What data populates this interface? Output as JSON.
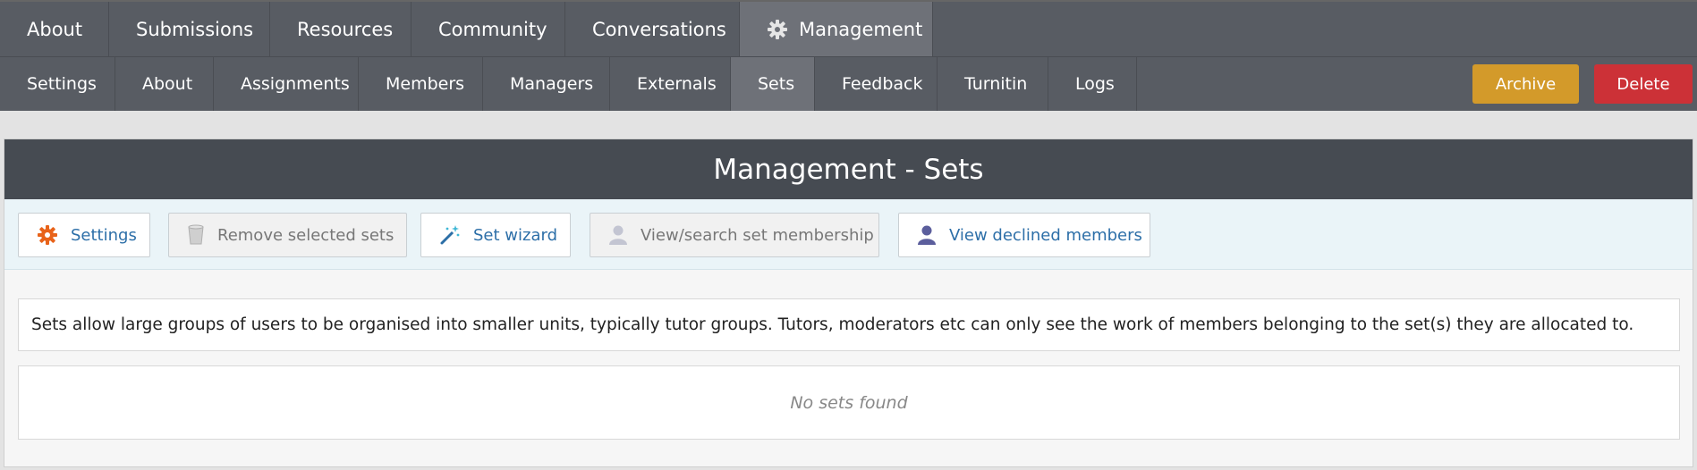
{
  "top_nav": {
    "tabs": [
      {
        "label": "About"
      },
      {
        "label": "Submissions"
      },
      {
        "label": "Resources"
      },
      {
        "label": "Community"
      },
      {
        "label": "Conversations"
      },
      {
        "label": "Management",
        "icon": "gear-icon",
        "active": true
      }
    ]
  },
  "sub_nav": {
    "tabs": [
      {
        "label": "Settings"
      },
      {
        "label": "About"
      },
      {
        "label": "Assignments"
      },
      {
        "label": "Members"
      },
      {
        "label": "Managers"
      },
      {
        "label": "Externals"
      },
      {
        "label": "Sets",
        "active": true
      },
      {
        "label": "Feedback"
      },
      {
        "label": "Turnitin"
      },
      {
        "label": "Logs"
      }
    ],
    "archive_label": "Archive",
    "delete_label": "Delete"
  },
  "panel": {
    "title": "Management - Sets",
    "toolbar": {
      "settings_label": "Settings",
      "remove_label": "Remove selected sets",
      "wizard_label": "Set wizard",
      "view_search_label": "View/search set membership",
      "declined_label": "View declined members"
    },
    "info_text": "Sets allow large groups of users to be organised into smaller units, typically tutor groups. Tutors, moderators etc can only see the work of members belonging to the set(s) they are allocated to.",
    "empty_text": "No sets found"
  },
  "colors": {
    "nav_bg": "#585c63",
    "nav_active": "#6e7178",
    "archive": "#d39a2a",
    "delete": "#cc3137",
    "panel_header": "#464b52",
    "link_blue": "#2d6fa8"
  }
}
